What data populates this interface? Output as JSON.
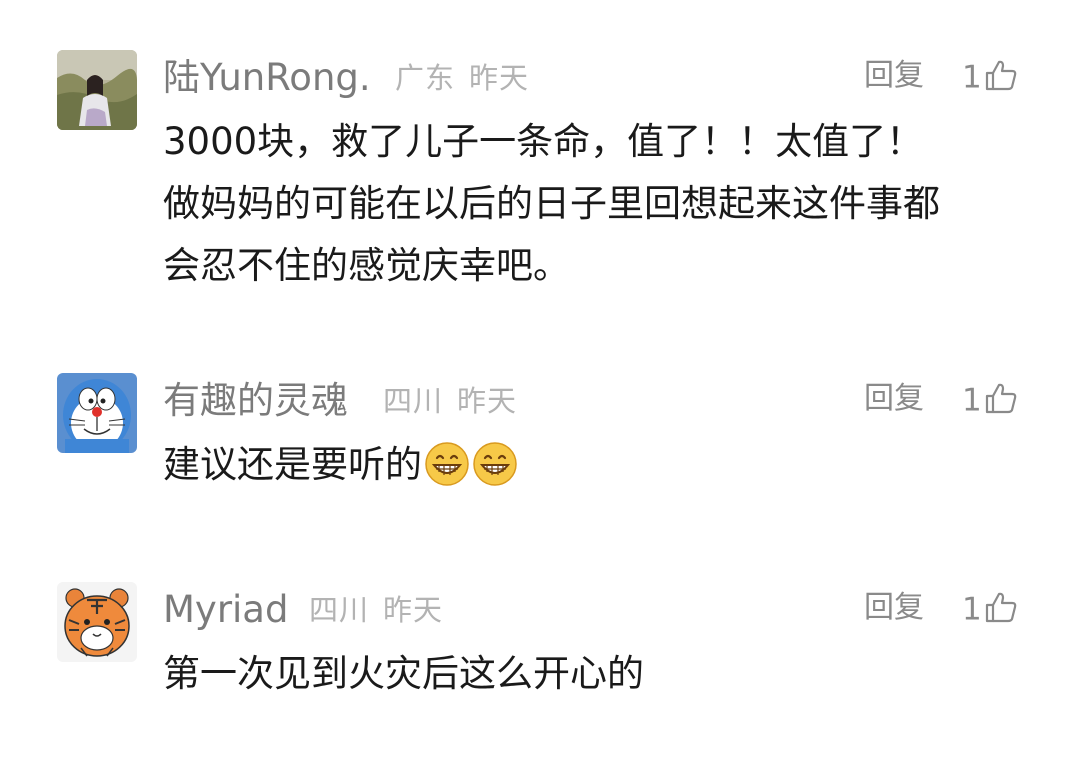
{
  "comments": [
    {
      "avatar": "girl-photo-avatar",
      "name": "陆YunRong.",
      "location": "广东",
      "time": "昨天",
      "reply_label": "回复",
      "likes": "1",
      "lines": [
        "3000块，救了儿子一条命，值了！！太值了！",
        "做妈妈的可能在以后的日子里回想起来这件事都",
        "会忍不住的感觉庆幸吧。"
      ]
    },
    {
      "avatar": "doraemon-avatar",
      "name": "有趣的灵魂",
      "location": "四川",
      "time": "昨天",
      "reply_label": "回复",
      "likes": "1",
      "text": "建议还是要听的",
      "emojis": [
        "grinning-face-emoji",
        "grinning-face-emoji"
      ]
    },
    {
      "avatar": "tiger-avatar",
      "name": "Myriad",
      "location": "四川",
      "time": "昨天",
      "reply_label": "回复",
      "likes": "1",
      "text": "第一次见到火灾后这么开心的"
    }
  ],
  "icons": {
    "like": "thumbs-up-icon"
  },
  "colors": {
    "name": "#7b7b7b",
    "meta": "#b3b3b3",
    "body": "#1a1a1a",
    "action": "#8a8a8a"
  }
}
